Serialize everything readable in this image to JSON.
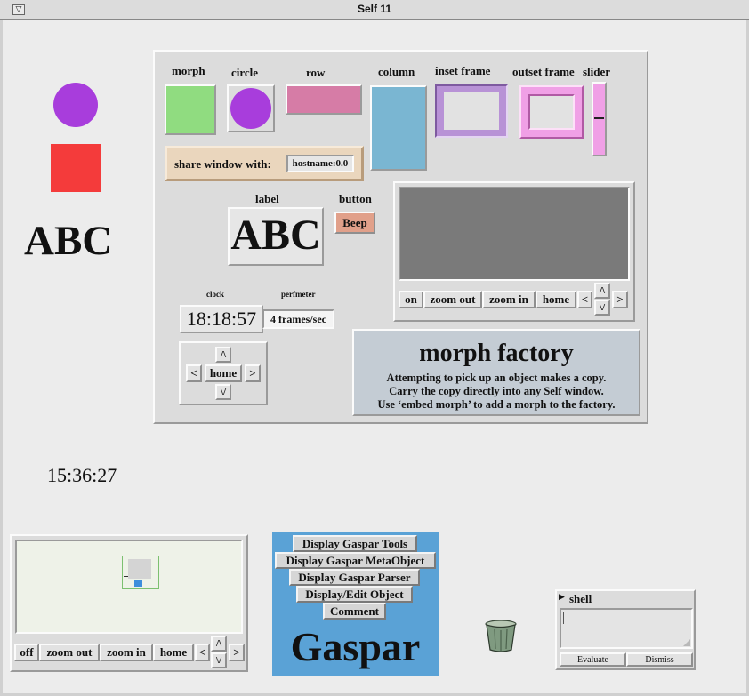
{
  "window": {
    "title": "Self 11",
    "menu_glyph": "▽"
  },
  "desktop": {
    "big_label": "ABC",
    "clock": "15:36:27"
  },
  "factory": {
    "labels": {
      "morph": "morph",
      "circle": "circle",
      "row": "row",
      "column": "column",
      "inset_frame": "inset frame",
      "outset_frame": "outset frame",
      "slider": "slider",
      "label": "label",
      "button": "button",
      "clock": "clock",
      "perfmeter": "perfmeter"
    },
    "share_label": "share window with:",
    "share_value": "hostname:0.0",
    "label_sample": "ABC",
    "beep": "Beep",
    "clock_value": "18:18:57",
    "perf_value": "4 frames/sec",
    "nav": {
      "up": "/\\",
      "down": "\\/",
      "left": "<",
      "right": ">",
      "home": "home"
    },
    "view_controls": {
      "on": "on",
      "zoom_out": "zoom out",
      "zoom_in": "zoom in",
      "home": "home",
      "left": "<",
      "right": ">",
      "up": "/\\",
      "down": "\\/"
    },
    "title": "morph factory",
    "desc1": "Attempting to pick up an object makes a copy.",
    "desc2": "Carry the copy directly into any Self window.",
    "desc3": "Use ‘embed morph’ to add a morph to the factory."
  },
  "radar": {
    "off": "off",
    "zoom_out": "zoom out",
    "zoom_in": "zoom in",
    "home": "home",
    "left": "<",
    "right": ">",
    "up": "/\\",
    "down": "\\/"
  },
  "gaspar": {
    "items": [
      "Display Gaspar Tools",
      "Display Gaspar MetaObject",
      "Display Gaspar Parser",
      "Display/Edit Object",
      "Comment"
    ],
    "title": "Gaspar"
  },
  "shell": {
    "title": "shell",
    "evaluate": "Evaluate",
    "dismiss": "Dismiss"
  },
  "colors": {
    "purple": "#a83ddc",
    "red": "#f43b3b",
    "green": "#90dc80",
    "pink_row": "#d67ca6",
    "column_blue": "#7ab6d2",
    "inset_purple": "#b892d6",
    "outset_pink": "#f0a0e6",
    "factory_info_bg": "#c4ccd4",
    "beep_bg": "#e1a08a",
    "share_bg": "#ead6bd",
    "gaspar_bg": "#5aa2d6"
  }
}
